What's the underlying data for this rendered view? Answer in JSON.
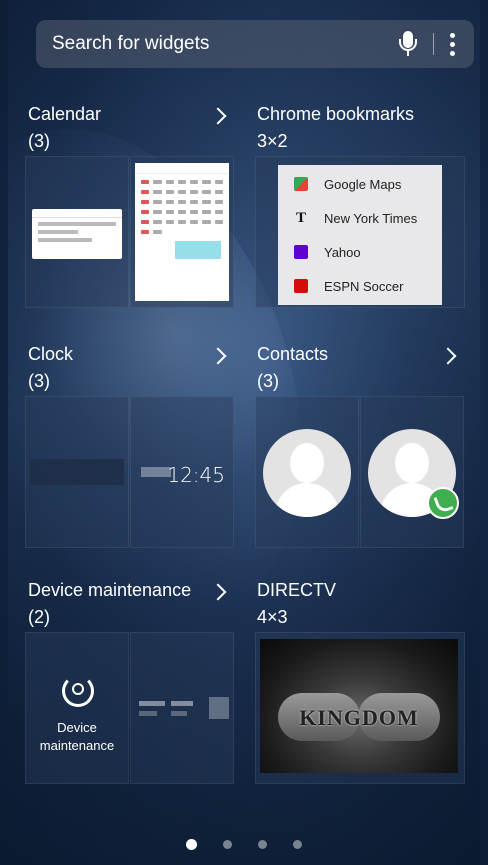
{
  "search": {
    "placeholder": "Search for widgets",
    "mic_icon": "mic-icon",
    "more_icon": "more-vert-icon"
  },
  "widgets": [
    {
      "title": "Calendar",
      "subtitle": "(3)",
      "has_chevron": true
    },
    {
      "title": "Chrome bookmarks",
      "subtitle": "3×2",
      "has_chevron": false
    },
    {
      "title": "Clock",
      "subtitle": "(3)",
      "has_chevron": true
    },
    {
      "title": "Contacts",
      "subtitle": "(3)",
      "has_chevron": true
    },
    {
      "title": "Device maintenance",
      "subtitle": "(2)",
      "has_chevron": true
    },
    {
      "title": "DIRECTV",
      "subtitle": "4×3",
      "has_chevron": false
    }
  ],
  "bookmarks": [
    {
      "label": "Google Maps",
      "color": "#34a853"
    },
    {
      "label": "New York Times",
      "color": "#111111"
    },
    {
      "label": "Yahoo",
      "color": "#5f01d1"
    },
    {
      "label": "ESPN Soccer",
      "color": "#d50a0a"
    }
  ],
  "clock": {
    "time": "12:45"
  },
  "device_maintenance": {
    "label_line1": "Device",
    "label_line2": "maintenance"
  },
  "directv": {
    "image_text": "KINGDOM"
  },
  "pager": {
    "pages": 4,
    "active": 0
  }
}
